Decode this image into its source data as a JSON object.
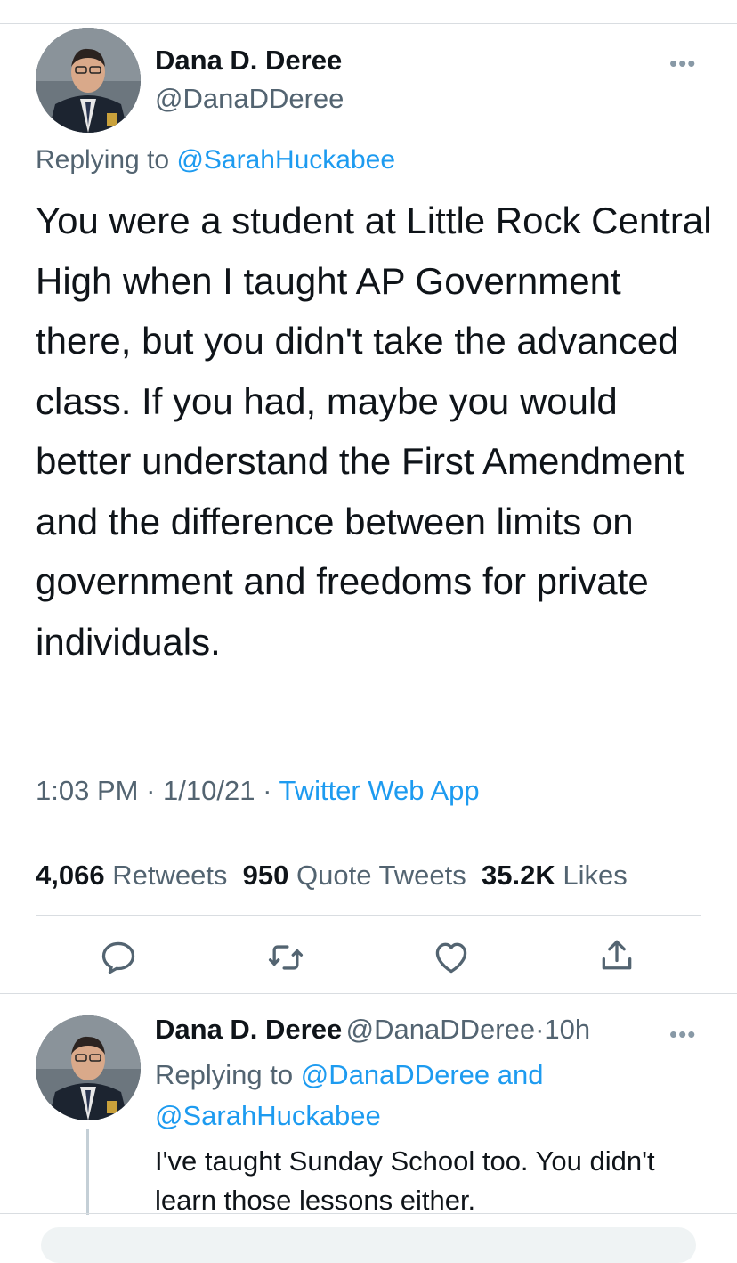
{
  "tweet": {
    "author_name": "Dana D. Deree",
    "author_handle": "@DanaDDeree",
    "more_label": "•••",
    "replying_prefix": "Replying to",
    "replying_to": "@SarahHuckabee",
    "text": "You were a student at Little Rock Central High when I taught AP Government there, but you didn't take the advanced class. If you had, maybe you would better understand the First Amendment and the difference between limits on government and freedoms for private individuals.",
    "time": "1:03 PM",
    "date": "1/10/21",
    "source": "Twitter Web App",
    "sep": " · ",
    "stats": {
      "retweets_count": "4,066",
      "retweets_label": "Retweets",
      "quotes_count": "950",
      "quotes_label": "Quote Tweets",
      "likes_count": "35.2K",
      "likes_label": "Likes"
    },
    "actions": [
      "reply-icon",
      "retweet-icon",
      "like-icon",
      "share-icon"
    ]
  },
  "reply": {
    "author_name": "Dana D. Deree",
    "author_handle": "@DanaDDeree",
    "dot": "·",
    "age": "10h",
    "more_label": "•••",
    "replying_prefix": "Replying to",
    "replying_to_1": "@DanaDDeree",
    "replying_and": "and",
    "replying_to_2": "@SarahHuckabee",
    "text": "I've taught Sunday School too. You didn't learn those lessons either."
  },
  "colors": {
    "accent": "#1d9bf0",
    "secondary_text": "#536471",
    "divider": "#d9dde1"
  }
}
